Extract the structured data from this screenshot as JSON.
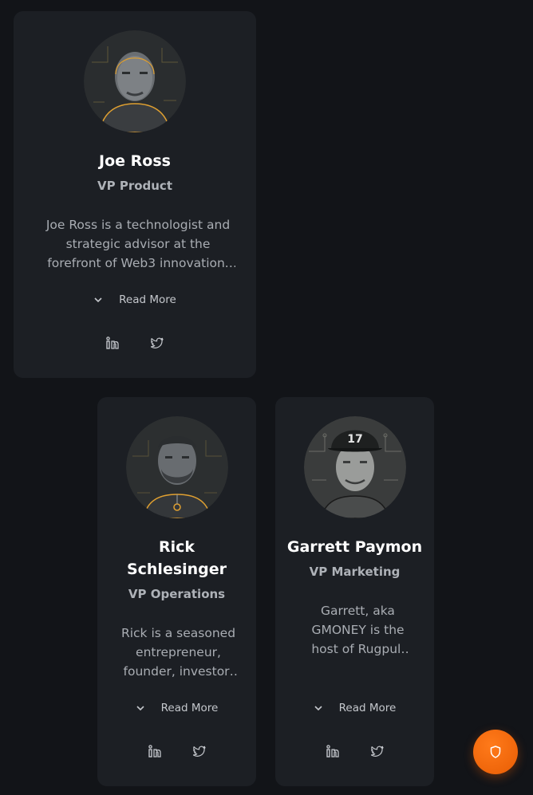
{
  "team": [
    {
      "name": "Joe Ross",
      "role": "VP Product",
      "bio": "Joe Ross is a technologist and strategic advisor at the forefront of Web3 innovation. He has spent years building products.",
      "read_more": "Read More"
    },
    {
      "name": "Rick Schlesinger",
      "role": "VP Operations",
      "bio": "Rick is a seasoned entrepreneur, founder, investor, and operator with decades of experience.",
      "read_more": "Read More"
    },
    {
      "name": "Garrett Paymon",
      "role": "VP Marketing",
      "bio": "Garrett, aka GMONEY is the host of Rugpull podcast and a longtime voice in crypto.",
      "read_more": "Read More"
    }
  ],
  "icons": {
    "linkedin": "linkedin-icon",
    "twitter": "twitter-icon",
    "chevron": "chevron-down-icon",
    "shield": "shield-icon"
  },
  "colors": {
    "background": "#121418",
    "card": "#1c1f24",
    "accent": "#e85d04",
    "avatar_ring": "#e0a030"
  }
}
